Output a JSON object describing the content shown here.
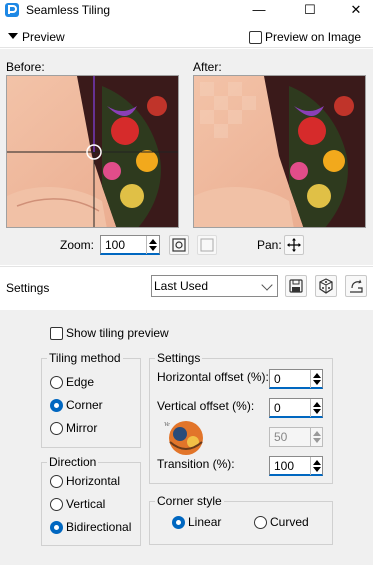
{
  "window": {
    "title": "Seamless Tiling",
    "minimize": "—",
    "maximize": "☐",
    "close": "✕"
  },
  "preview": {
    "section_label": "Preview",
    "preview_on_image_label": "Preview on Image",
    "before_label": "Before:",
    "after_label": "After:",
    "zoom_label": "Zoom:",
    "zoom_value": "100",
    "pan_label": "Pan:"
  },
  "settings_bar": {
    "label": "Settings",
    "preset_value": "Last Used"
  },
  "options": {
    "show_tiling_preview_label": "Show tiling preview",
    "show_tiling_preview_checked": false,
    "tiling_method": {
      "title": "Tiling method",
      "items": [
        {
          "label": "Edge",
          "selected": false
        },
        {
          "label": "Corner",
          "selected": true
        },
        {
          "label": "Mirror",
          "selected": false
        }
      ]
    },
    "direction": {
      "title": "Direction",
      "items": [
        {
          "label": "Horizontal",
          "selected": false
        },
        {
          "label": "Vertical",
          "selected": false
        },
        {
          "label": "Bidirectional",
          "selected": true
        }
      ]
    },
    "settings_group": {
      "title": "Settings",
      "horizontal_offset_label": "Horizontal offset (%):",
      "horizontal_offset_value": "0",
      "vertical_offset_label": "Vertical offset (%):",
      "vertical_offset_value": "0",
      "width_value": "50",
      "transition_label": "Transition (%):",
      "transition_value": "100"
    },
    "corner_style": {
      "title": "Corner style",
      "items": [
        {
          "label": "Linear",
          "selected": true
        },
        {
          "label": "Curved",
          "selected": false
        }
      ]
    }
  },
  "colors": {
    "accent": "#0067c0",
    "panel": "#f0f0f0"
  }
}
